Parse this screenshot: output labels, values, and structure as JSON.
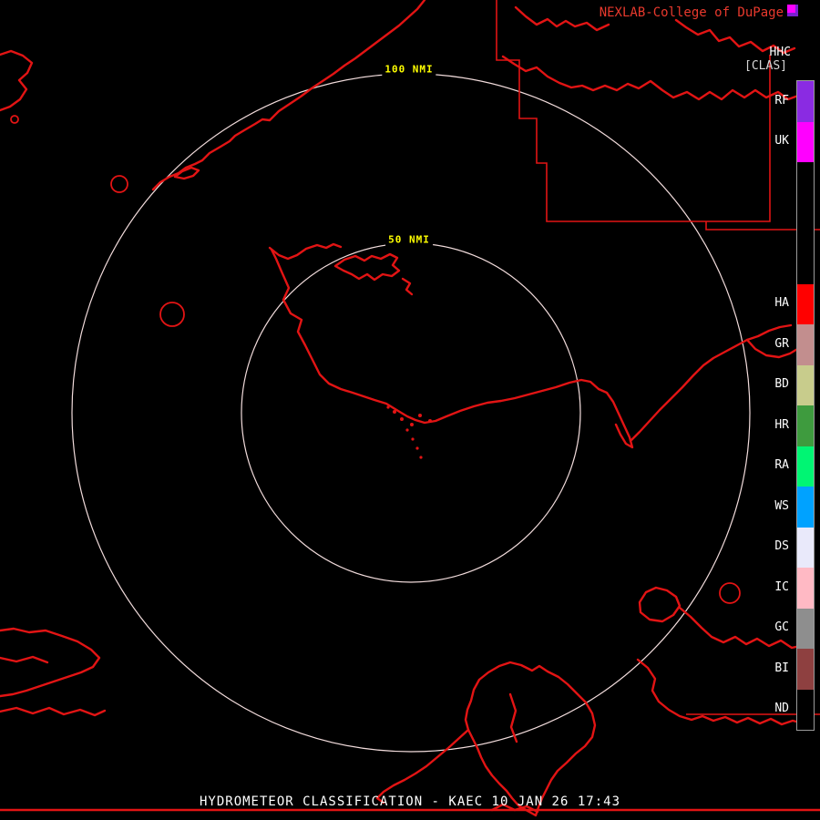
{
  "header": {
    "brand": "NEXLAB-College of DuPage",
    "product_code": "HHC",
    "classification": "[CLAS]"
  },
  "range_rings": [
    {
      "label": "100 NMI"
    },
    {
      "label": "50 NMI"
    }
  ],
  "legend": {
    "categories": [
      {
        "label": "RF",
        "color": "#8a2be2"
      },
      {
        "label": "UK",
        "color": "#ff00ff"
      },
      {
        "label": "",
        "color": "#000000"
      },
      {
        "label": "",
        "color": "#000000"
      },
      {
        "label": "",
        "color": "#000000"
      },
      {
        "label": "HA",
        "color": "#ff0000"
      },
      {
        "label": "GR",
        "color": "#c28e8e"
      },
      {
        "label": "BD",
        "color": "#c8cc8c"
      },
      {
        "label": "HR",
        "color": "#3e9b3e"
      },
      {
        "label": "RA",
        "color": "#00f573"
      },
      {
        "label": "WS",
        "color": "#00a2ff"
      },
      {
        "label": "DS",
        "color": "#e9e9fa"
      },
      {
        "label": "IC",
        "color": "#ffb9c4"
      },
      {
        "label": "GC",
        "color": "#8e8e8e"
      },
      {
        "label": "BI",
        "color": "#8e4040"
      },
      {
        "label": "ND",
        "color": "#000000"
      }
    ]
  },
  "footer": {
    "product": "HYDROMETEOR CLASSIFICATION",
    "station": "KAEC",
    "datetime": "10 JAN 26 17:43",
    "title": "HYDROMETEOR CLASSIFICATION - KAEC 10 JAN 26 17:43"
  },
  "colors": {
    "background": "#000000",
    "map_outline": "#e21414",
    "ring": "#f2dcdc",
    "ring_label": "#ffff00",
    "brand_text": "#e8392d",
    "station_icon": "#ff00ff",
    "label_text": "#ffffff"
  }
}
